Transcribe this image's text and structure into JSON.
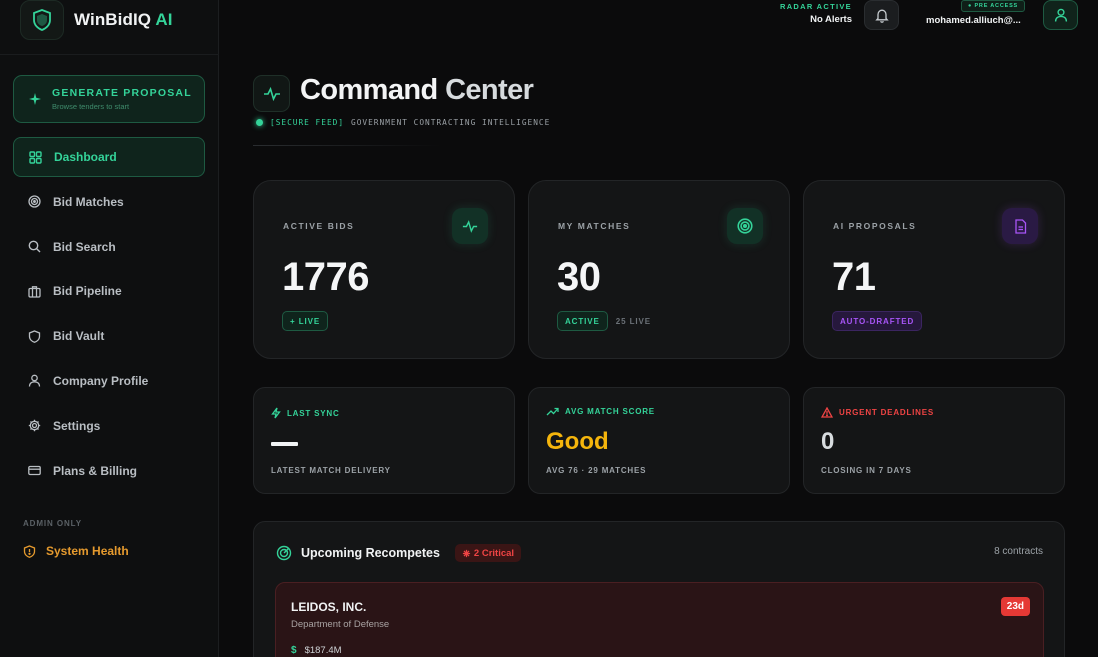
{
  "brand": {
    "name": "WinBidIQ",
    "suffix": "AI"
  },
  "sidebar": {
    "generate": {
      "title": "GENERATE PROPOSAL",
      "subtitle": "Browse tenders to start"
    },
    "items": [
      {
        "label": "Dashboard",
        "icon": "dashboard-icon",
        "active": true
      },
      {
        "label": "Bid Matches",
        "icon": "target-icon"
      },
      {
        "label": "Bid Search",
        "icon": "search-icon"
      },
      {
        "label": "Bid Pipeline",
        "icon": "briefcase-icon"
      },
      {
        "label": "Bid Vault",
        "icon": "shield-icon"
      },
      {
        "label": "Company Profile",
        "icon": "user-icon"
      },
      {
        "label": "Settings",
        "icon": "gear-icon"
      },
      {
        "label": "Plans & Billing",
        "icon": "credit-card-icon"
      }
    ],
    "admin_label": "ADMIN ONLY",
    "system_health": "System Health"
  },
  "topbar": {
    "radar_label": "RADAR ACTIVE",
    "radar_value": "No Alerts",
    "pre_access": "● PRE ACCESS",
    "user_email": "mohamed.alliuch@..."
  },
  "header": {
    "title_a": "Command",
    "title_b": "Center",
    "secure": "[SECURE FEED]",
    "subtitle": "GOVERNMENT CONTRACTING INTELLIGENCE"
  },
  "stats": {
    "active_bids": {
      "label": "ACTIVE BIDS",
      "value": "1776",
      "tag": "+ LIVE"
    },
    "my_matches": {
      "label": "MY MATCHES",
      "value": "30",
      "tag": "ACTIVE",
      "extra": "25 LIVE"
    },
    "ai_proposals": {
      "label": "AI PROPOSALS",
      "value": "71",
      "tag": "AUTO-DRAFTED"
    }
  },
  "mini": {
    "last_sync": {
      "label": "LAST SYNC",
      "sub": "LATEST MATCH DELIVERY"
    },
    "avg_score": {
      "label": "AVG MATCH SCORE",
      "value": "Good",
      "sub": "AVG 76 · 29 MATCHES"
    },
    "urgent": {
      "label": "URGENT DEADLINES",
      "value": "0",
      "sub": "CLOSING IN 7 DAYS"
    }
  },
  "recompetes": {
    "title": "Upcoming Recompetes",
    "critical": "2 Critical",
    "count": "8 contracts",
    "first": {
      "name": "LEIDOS, INC.",
      "agency": "Department of Defense",
      "value": "$187.4M",
      "days": "23d"
    }
  },
  "colors": {
    "accent": "#34d399",
    "warning": "#e59a2e",
    "danger": "#ef4444",
    "purple": "#a855f7",
    "gold": "#f5b50c"
  }
}
